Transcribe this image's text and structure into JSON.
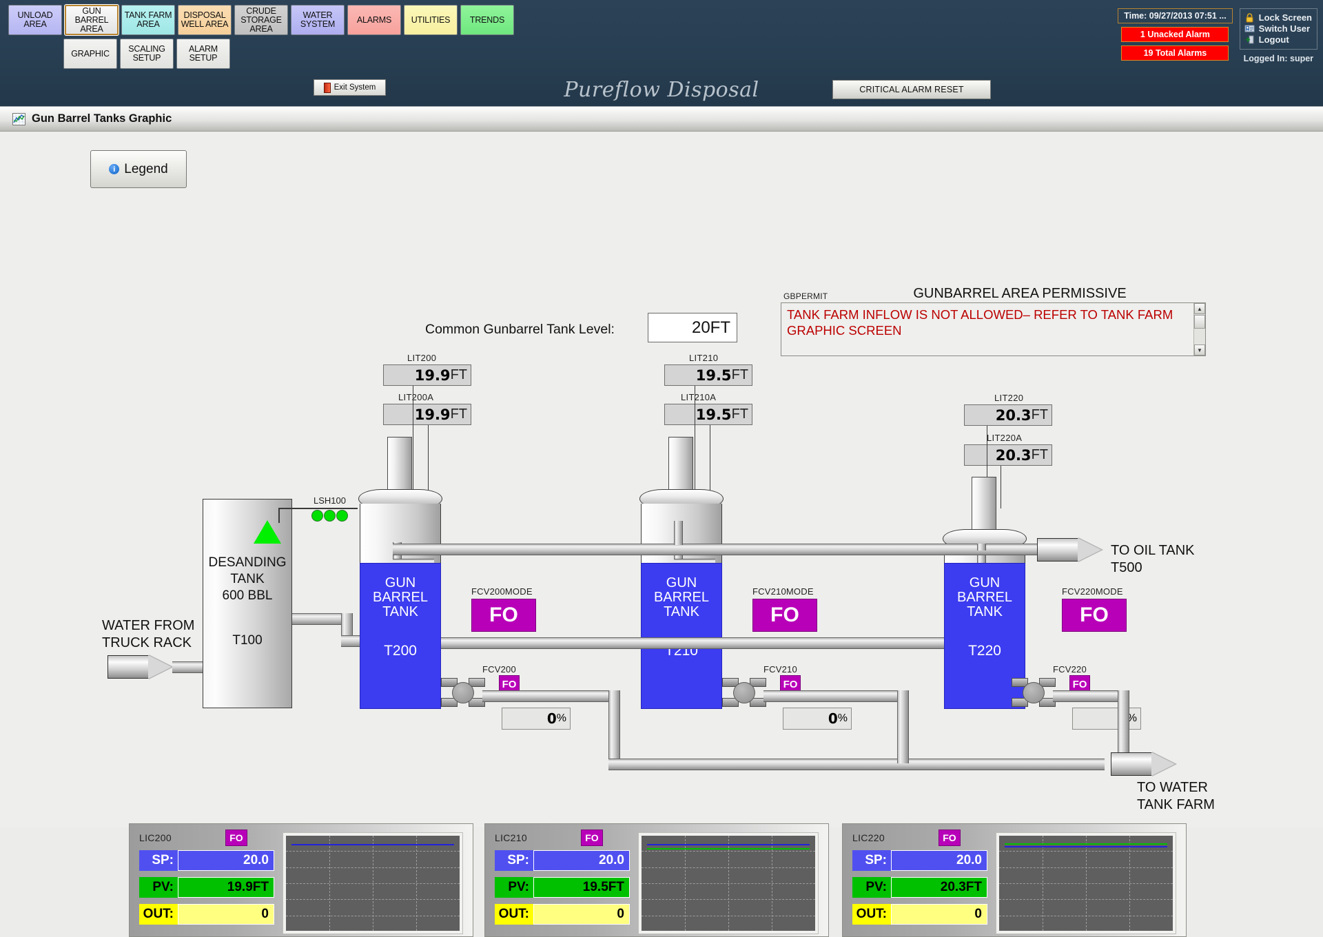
{
  "nav": {
    "row1": [
      {
        "label_lines": [
          "UNLOAD",
          "AREA"
        ],
        "key": "unload"
      },
      {
        "label_lines": [
          "GUN",
          "BARREL",
          "AREA"
        ],
        "key": "gun"
      },
      {
        "label_lines": [
          "TANK FARM",
          "AREA"
        ],
        "key": "tank"
      },
      {
        "label_lines": [
          "DISPOSAL",
          "WELL AREA"
        ],
        "key": "disposal"
      },
      {
        "label_lines": [
          "CRUDE",
          "STORAGE",
          "AREA"
        ],
        "key": "crude"
      },
      {
        "label_lines": [
          "WATER",
          "SYSTEM"
        ],
        "key": "water"
      },
      {
        "label_lines": [
          "ALARMS"
        ],
        "key": "alarms"
      },
      {
        "label_lines": [
          "UTILITIES"
        ],
        "key": "utilities"
      },
      {
        "label_lines": [
          "TRENDS"
        ],
        "key": "trends"
      }
    ],
    "row2": [
      {
        "label_lines": [
          "GRAPHIC"
        ],
        "key": "graphic"
      },
      {
        "label_lines": [
          "SCALING",
          "SETUP"
        ],
        "key": "scaling"
      },
      {
        "label_lines": [
          "ALARM",
          "SETUP"
        ],
        "key": "alarmsetup"
      }
    ]
  },
  "status": {
    "time": "Time: 09/27/2013 07:51 ...",
    "unacked_alarms": "1 Unacked Alarm",
    "total_alarms": "19 Total Alarms",
    "lock_screen": "Lock Screen",
    "switch_user": "Switch User",
    "logout": "Logout",
    "logged_in": "Logged In: super"
  },
  "header": {
    "exit_label": "Exit System",
    "brand": "Pureflow Disposal",
    "critical_reset": "CRITICAL ALARM RESET"
  },
  "window": {
    "title": "Gun Barrel Tanks Graphic"
  },
  "graphic": {
    "legend_label": "Legend",
    "common_level_label": "Common Gunbarrel Tank Level:",
    "common_level_value": "20FT",
    "permissive": {
      "tag": "GBPERMIT",
      "title": "GUNBARREL AREA PERMISSIVE",
      "message": "TANK FARM INFLOW IS NOT ALLOWED– REFER TO TANK FARM GRAPHIC SCREEN"
    },
    "desanding_tank": {
      "line1": "DESANDING",
      "line2": "TANK",
      "line3": "600 BBL",
      "id": "T100",
      "lsh_tag": "LSH100"
    },
    "inlet_label_l1": "WATER FROM",
    "inlet_label_l2": "TRUCK RACK",
    "oil_outlet_l1": "TO OIL TANK",
    "oil_outlet_l2": "T500",
    "water_outlet_l1": "TO WATER",
    "water_outlet_l2": "TANK FARM",
    "tank_caption_l1": "GUN",
    "tank_caption_l2": "BARREL",
    "tank_caption_l3": "TANK",
    "trains": [
      {
        "tank_id": "T200",
        "lit_tag": "LIT200",
        "lit_value": "19.9",
        "lit_unit": "FT",
        "lit_a_tag": "LIT200A",
        "lit_a_value": "19.9",
        "lit_a_unit": "FT",
        "mode_tag": "FCV200MODE",
        "mode_value": "FO",
        "fcv_tag": "FCV200",
        "fcv_mode": "FO",
        "fcv_pct": "0",
        "fcv_pct_unit": "%"
      },
      {
        "tank_id": "T210",
        "lit_tag": "LIT210",
        "lit_value": "19.5",
        "lit_unit": "FT",
        "lit_a_tag": "LIT210A",
        "lit_a_value": "19.5",
        "lit_a_unit": "FT",
        "mode_tag": "FCV210MODE",
        "mode_value": "FO",
        "fcv_tag": "FCV210",
        "fcv_mode": "FO",
        "fcv_pct": "0",
        "fcv_pct_unit": "%"
      },
      {
        "tank_id": "T220",
        "lit_tag": "LIT220",
        "lit_value": "20.3",
        "lit_unit": "FT",
        "lit_a_tag": "LIT220A",
        "lit_a_value": "20.3",
        "lit_a_unit": "FT",
        "mode_tag": "FCV220MODE",
        "mode_value": "FO",
        "fcv_tag": "FCV220",
        "fcv_mode": "FO",
        "fcv_pct": "0",
        "fcv_pct_unit": "%"
      }
    ],
    "faceplates": [
      {
        "tag": "LIC200",
        "mode": "FO",
        "sp_label": "SP:",
        "sp_value": "20.0",
        "pv_label": "PV:",
        "pv_value": "19.9FT",
        "out_label": "OUT:",
        "out_value": "0",
        "trend": {
          "blue_level_pct": 9,
          "green_level_pct": 9,
          "green_visible": false
        }
      },
      {
        "tag": "LIC210",
        "mode": "FO",
        "sp_label": "SP:",
        "sp_value": "20.0",
        "pv_label": "PV:",
        "pv_value": "19.5FT",
        "out_label": "OUT:",
        "out_value": "0",
        "trend": {
          "blue_level_pct": 9,
          "green_level_pct": 13,
          "green_visible": true
        }
      },
      {
        "tag": "LIC220",
        "mode": "FO",
        "sp_label": "SP:",
        "sp_value": "20.0",
        "pv_label": "PV:",
        "pv_value": "20.3FT",
        "out_label": "OUT:",
        "out_value": "0",
        "trend": {
          "blue_level_pct": 11,
          "green_level_pct": 8,
          "green_visible": true
        }
      }
    ]
  },
  "colors": {
    "tank_blue": "#3c3cf0",
    "mode_magenta": "#b800b8",
    "alarm_red": "#ff0000",
    "pv_green": "#00c000",
    "out_yellow": "#ffff00",
    "nav_bg": "#294054"
  }
}
